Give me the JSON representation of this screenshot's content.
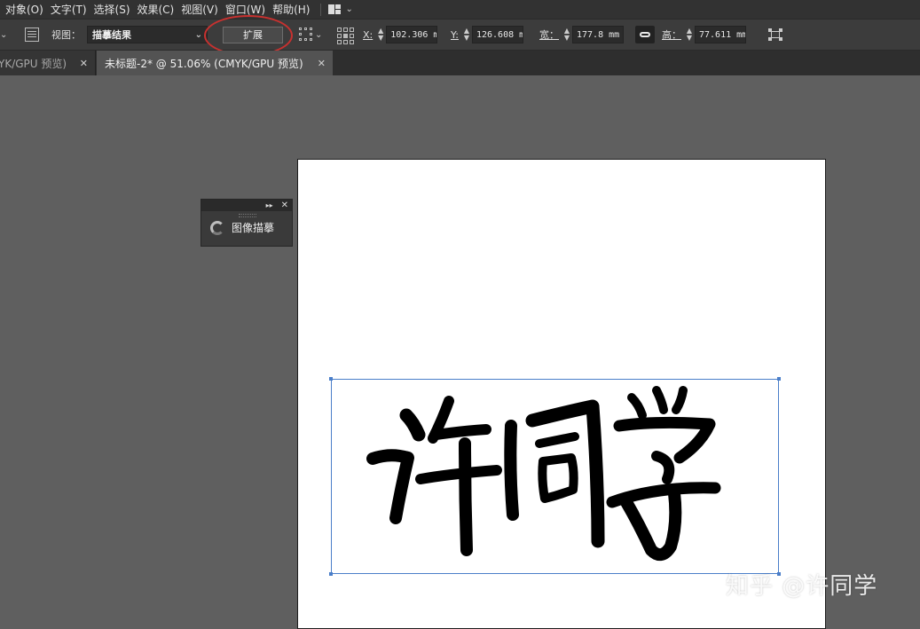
{
  "menubar": {
    "items": [
      "对象(O)",
      "文字(T)",
      "选择(S)",
      "效果(C)",
      "视图(V)",
      "窗口(W)",
      "帮助(H)"
    ]
  },
  "controlbar": {
    "view_label": "视图：",
    "view_value": "描摹结果",
    "expand_label": "扩展",
    "x_label": "X:",
    "x_value": "102.306 m",
    "y_label": "Y:",
    "y_value": "126.608 m",
    "w_label": "宽：",
    "w_value": "177.8 mm",
    "h_label": "高：",
    "h_value": "77.611 mm"
  },
  "tabs": [
    {
      "label": "YK/GPU 预览)",
      "active": false
    },
    {
      "label": "未标题-2* @ 51.06% (CMYK/GPU 预览)",
      "active": true
    }
  ],
  "panel": {
    "title_label": "图像描摹"
  },
  "artwork": {
    "text": "许同学"
  },
  "watermark": "知乎 @许同学",
  "colors": {
    "highlight": "#c8312f",
    "selection": "#4a7ec9",
    "ui_dark": "#323232",
    "pasteboard": "#5f5f5f"
  }
}
